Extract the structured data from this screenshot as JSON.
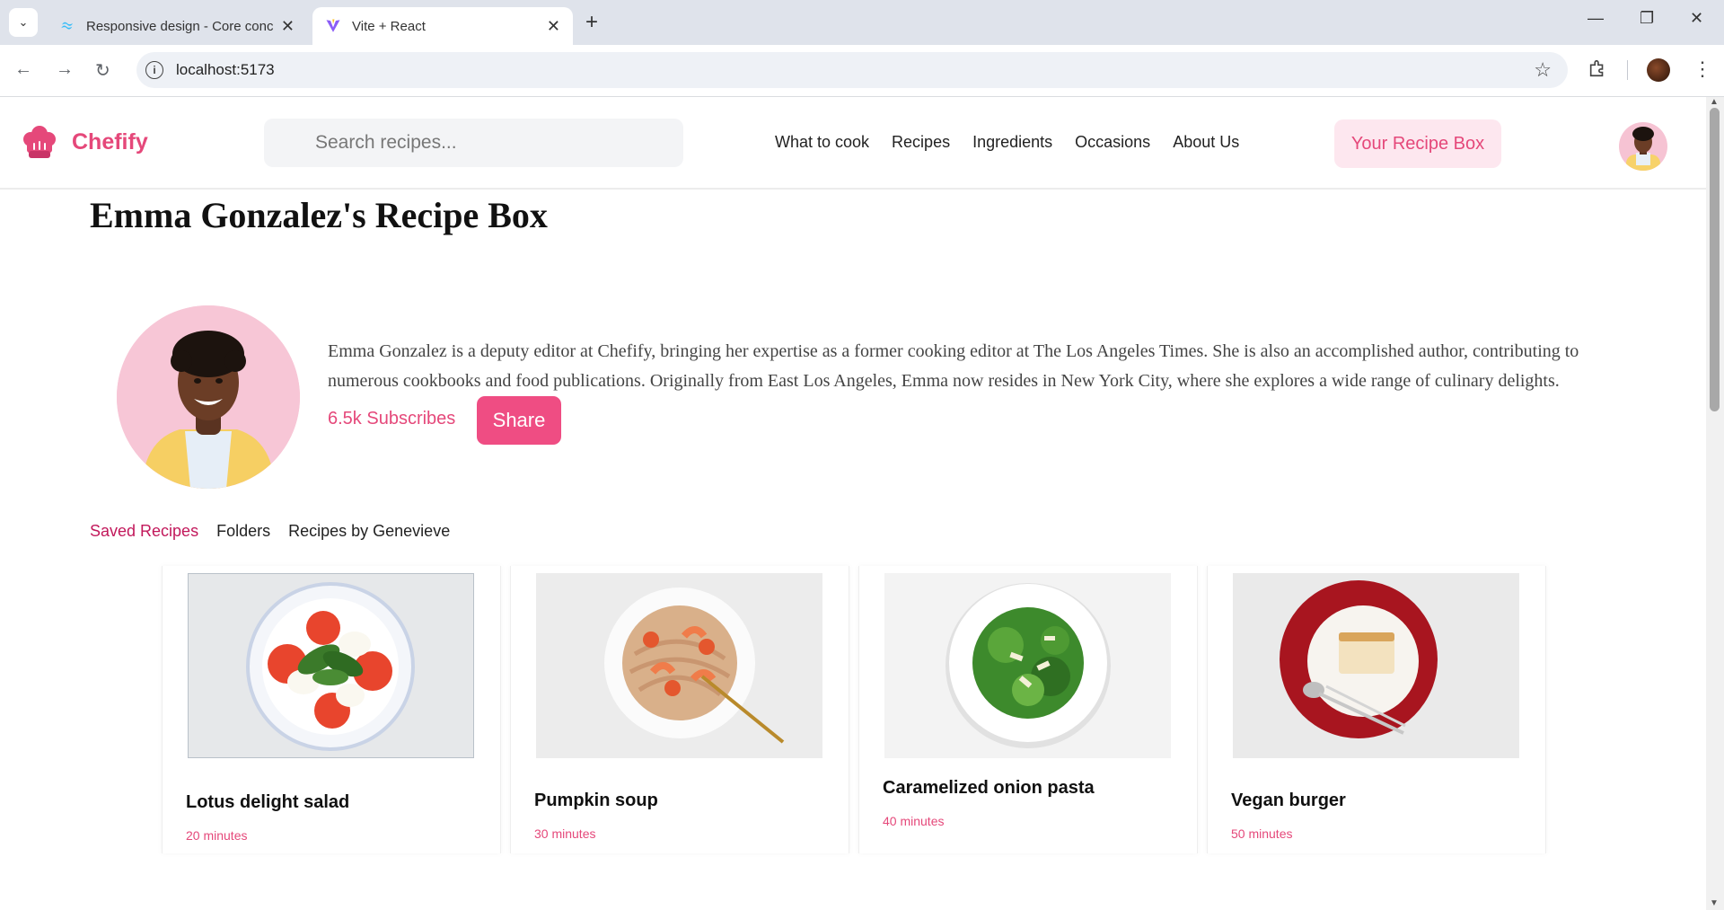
{
  "browser": {
    "tabs": [
      {
        "title": "Responsive design - Core conce",
        "active": false
      },
      {
        "title": "Vite + React",
        "active": true
      }
    ],
    "url": "localhost:5173"
  },
  "header": {
    "brand": "Chefify",
    "search_placeholder": "Search recipes...",
    "nav": [
      "What to cook",
      "Recipes",
      "Ingredients",
      "Occasions",
      "About Us"
    ],
    "recipe_box_label": "Your Recipe Box"
  },
  "profile": {
    "title": "Emma Gonzalez's Recipe Box",
    "bio": "Emma Gonzalez is a deputy editor at Chefify, bringing her expertise as a former cooking editor at The Los Angeles Times. She is also an accomplished author, contributing to numerous cookbooks and food publications. Originally from East Los Angeles, Emma now resides in New York City, where she explores a wide range of culinary delights.",
    "subscribers": "6.5k Subscribes",
    "share_label": "Share"
  },
  "tabs": [
    {
      "label": "Saved Recipes",
      "active": true
    },
    {
      "label": "Folders",
      "active": false
    },
    {
      "label": "Recipes by Genevieve",
      "active": false
    }
  ],
  "recipes": [
    {
      "name": "Lotus delight salad",
      "time": "20 minutes"
    },
    {
      "name": "Pumpkin soup",
      "time": "30 minutes"
    },
    {
      "name": "Caramelized onion pasta",
      "time": "40 minutes"
    },
    {
      "name": "Vegan burger",
      "time": "50 minutes"
    }
  ],
  "colors": {
    "brand": "#e5487a",
    "share_button": "#ef4d83",
    "active_tab": "#c2185b"
  }
}
